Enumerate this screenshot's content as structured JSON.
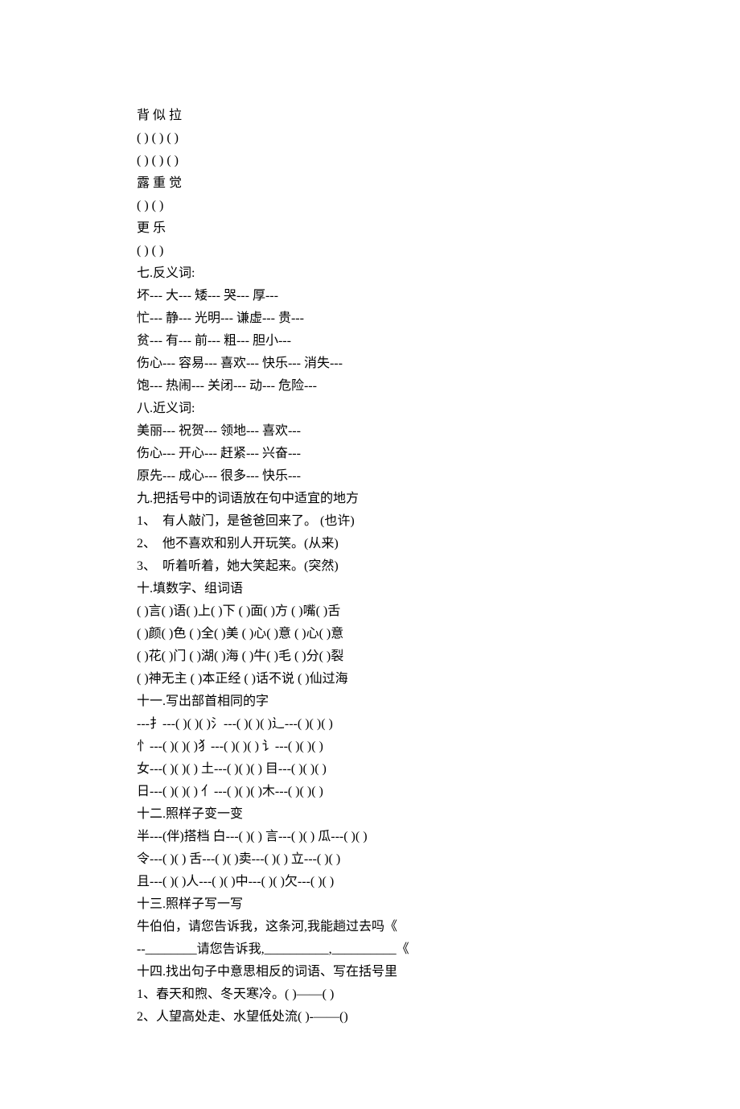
{
  "lines": [
    "背 似 拉",
    "( ) ( ) ( )",
    "( ) ( ) ( )",
    "露 重 觉",
    "( ) ( )",
    "更 乐",
    "( ) ( )",
    "七.反义词:",
    "坏--- 大--- 矮--- 哭--- 厚---",
    "忙--- 静--- 光明--- 谦虚--- 贵---",
    "贫--- 有--- 前--- 粗--- 胆小---",
    "伤心--- 容易--- 喜欢--- 快乐--- 消失---",
    "饱--- 热闹--- 关闭--- 动--- 危险---",
    "八.近义词:",
    "美丽--- 祝贺--- 领地--- 喜欢---",
    "伤心--- 开心--- 赶紧--- 兴奋---",
    "原先--- 成心--- 很多--- 快乐---",
    "九.把括号中的词语放在句中适宜的地方",
    "1、  有人敲门，是爸爸回来了。 (也许)",
    "2、  他不喜欢和别人开玩笑。(从来)",
    "3、  听着听着，她大笑起来。(突然)",
    "十.填数字、组词语",
    "( )言( )语( )上( )下 ( )面( )方 ( )嘴( )舌",
    "( )颜( )色 ( )全( )美 ( )心( )意 ( )心( )意",
    "( )花( )门 ( )湖( )海 ( )牛( )毛 ( )分( )裂",
    "( )神无主 ( )本正经 ( )话不说 ( )仙过海",
    "十一.写出部首相同的字",
    "---扌---( )( )( )氵---( )( )( )辶---( )( )( )",
    "忄---( )( )( )犭---( )( )( ) 讠---( )( )( )",
    "女---( )( )( ) 土---( )( )( ) 目---( )( )( )",
    "日---( )( )( ) 亻---( )( )( )木---( )( )( )",
    "十二.照样子变一变",
    "半---(伴)搭档 白---( )( ) 言---( )( ) 瓜---( )( )",
    "令---( )( ) 舌---( )( )卖---( )( ) 立---( )( )",
    "且---( )( )人---( )( )中---( )( )欠---( )( )",
    "十三.照样子写一写",
    "牛伯伯，请您告诉我，这条河,我能趟过去吗《",
    "--________请您告诉我,__________,__________《",
    "十四.找出句子中意思相反的词语、写在括号里",
    "1、春天和煦、冬天寒冷。( )——( )",
    "2、人望高处走、水望低处流( )-——()"
  ]
}
